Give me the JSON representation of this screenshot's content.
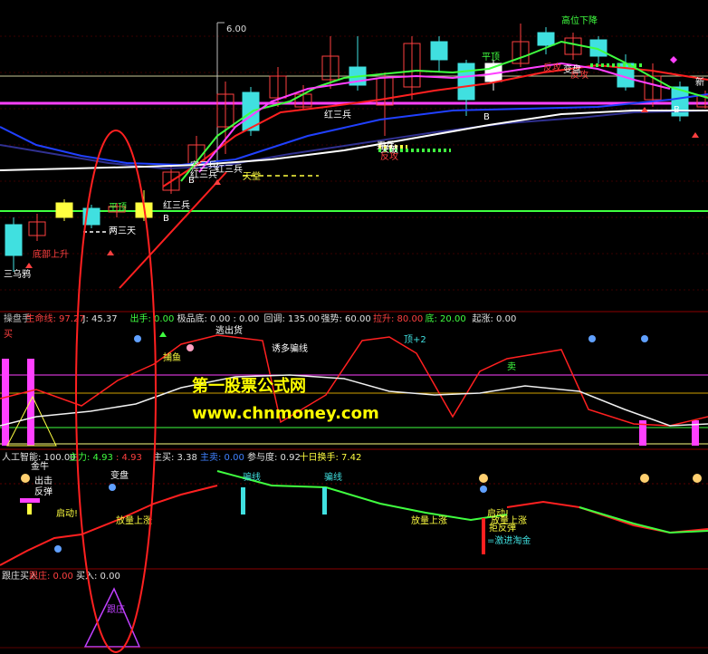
{
  "chart_data": [
    {
      "type": "candlestick",
      "panel": "main",
      "y_annotation": "6.00",
      "labels": [
        "三乌鸦",
        "底部上升",
        "两三天",
        "平顶",
        "红三兵",
        "红三兵",
        "空三兵",
        "天堂",
        "红三兵",
        "平顶",
        "高位下降",
        "反攻",
        "反攻",
        "反攻",
        "突破",
        "变盘",
        "新",
        "B",
        "B",
        "B",
        "B",
        "红三兵",
        "弄兵"
      ]
    },
    {
      "type": "line",
      "panel": "indicator-1",
      "header": [
        {
          "text": "操盘手",
          "color": "#c0c0c0"
        },
        {
          "text": "生命线: 97.27",
          "color": "#ff4040"
        },
        {
          "text": "J: 45.37",
          "color": "#e0e0e0"
        },
        {
          "text": "出手: 0.00",
          "color": "#40ff40"
        },
        {
          "text": "极品底: 0.00 : 0.00",
          "color": "#e0e0e0"
        },
        {
          "text": "回调: 135.00",
          "color": "#e0e0e0"
        },
        {
          "text": "强势: 60.00",
          "color": "#e0e0e0"
        },
        {
          "text": "拉升: 80.00",
          "color": "#ff4040"
        },
        {
          "text": "底: 20.00",
          "color": "#40ff40"
        },
        {
          "text": "起涨: 0.00",
          "color": "#e0e0e0"
        }
      ],
      "labels": [
        "买",
        "捕鱼",
        "逃出货",
        "诱多骗线",
        "顶+2",
        "卖"
      ]
    },
    {
      "type": "line",
      "panel": "indicator-2",
      "header": [
        {
          "text": "人工智能: 100.00",
          "color": "#e0e0e0"
        },
        {
          "text": "主力: 4.93",
          "color": "#40ff40"
        },
        {
          "text": ": 4.93",
          "color": "#ff4040"
        },
        {
          "text": "主买: 3.38",
          "color": "#e0e0e0"
        },
        {
          "text": "主卖: 0.00",
          "color": "#4080ff"
        },
        {
          "text": "参与度: 0.92",
          "color": "#e0e0e0"
        },
        {
          "text": "十日换手: 7.42",
          "color": "#ffff40"
        }
      ],
      "labels": [
        "金牛",
        "出击",
        "反弹",
        "启动!",
        "变盘",
        "放量上涨",
        "骗线",
        "骗线",
        "放量上涨",
        "启动!",
        "放量上涨",
        "拒反弹",
        "=激进淘金"
      ]
    },
    {
      "type": "line",
      "panel": "indicator-3",
      "header": [
        {
          "text": "跟庄买入",
          "color": "#e0e0e0"
        },
        {
          "text": "跟庄: 0.00",
          "color": "#ff4040"
        },
        {
          "text": "买入: 0.00",
          "color": "#e0e0e0"
        }
      ],
      "labels": [
        "跟庄"
      ]
    }
  ],
  "watermark": {
    "line1": "第一股票公式网",
    "line2": "www.chnmoney.com"
  },
  "colors": {
    "up": "#ff4040",
    "down": "#40e0e0",
    "yellow": "#ffff40",
    "green": "#40ff40",
    "magenta": "#ff40ff",
    "white": "#ffffff"
  }
}
